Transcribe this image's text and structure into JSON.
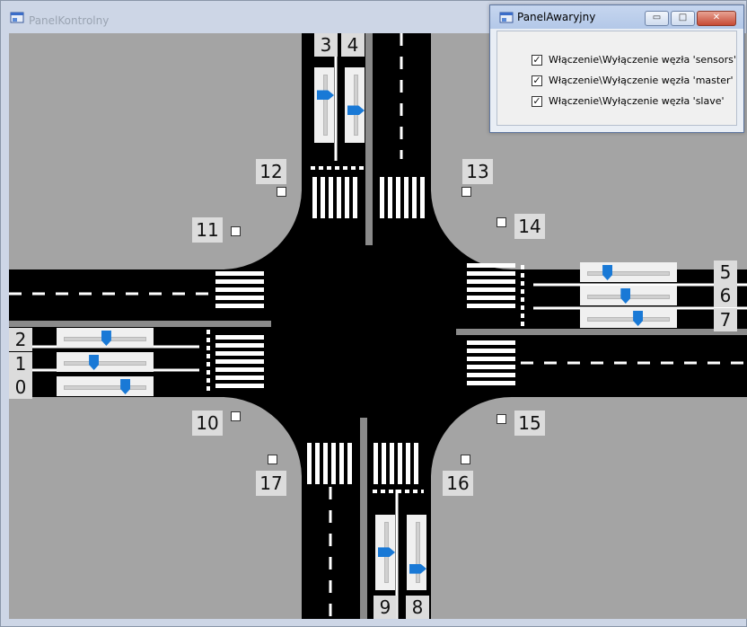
{
  "main_window": {
    "title": "PanelKontrolny"
  },
  "emergency_window": {
    "title": "PanelAwaryjny",
    "minimize_symbol": "▭",
    "maximize_symbol": "□",
    "close_symbol": "✕",
    "check_mark": "✓",
    "checkboxes": [
      {
        "label": "Włączenie\\Wyłączenie węzła 'sensors'",
        "checked": true
      },
      {
        "label": "Włączenie\\Wyłączenie węzła 'master'",
        "checked": true
      },
      {
        "label": "Włączenie\\Wyłączenie węzła 'slave'",
        "checked": true
      }
    ]
  },
  "lanes": [
    {
      "id": "0",
      "orientation": "horizontal",
      "value": 0.74
    },
    {
      "id": "1",
      "orientation": "horizontal",
      "value": 0.36
    },
    {
      "id": "2",
      "orientation": "horizontal",
      "value": 0.51
    },
    {
      "id": "3",
      "orientation": "vertical",
      "value": 0.33
    },
    {
      "id": "4",
      "orientation": "vertical",
      "value": 0.58
    },
    {
      "id": "5",
      "orientation": "horizontal",
      "value": 0.24
    },
    {
      "id": "6",
      "orientation": "horizontal",
      "value": 0.46
    },
    {
      "id": "7",
      "orientation": "horizontal",
      "value": 0.61
    },
    {
      "id": "8",
      "orientation": "vertical",
      "value": 0.76
    },
    {
      "id": "9",
      "orientation": "vertical",
      "value": 0.49
    }
  ],
  "sensors": [
    "10",
    "11",
    "12",
    "13",
    "14",
    "15",
    "16",
    "17"
  ],
  "colors": {
    "asphalt": "#000000",
    "ground": "#a4a4a4",
    "slider_thumb": "#1979d6"
  },
  "icons": {
    "app": "app-window-icon"
  }
}
